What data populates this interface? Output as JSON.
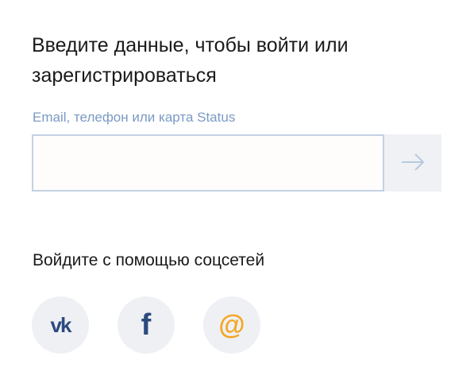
{
  "login": {
    "title": "Введите данные, чтобы войти или зарегистрироваться",
    "field_label": "Email, телефон или карта Status",
    "input_value": "",
    "input_placeholder": "",
    "submit_icon": "arrow-right-icon"
  },
  "social": {
    "title": "Войдите с помощью соцсетей",
    "buttons": [
      {
        "name": "vk",
        "icon": "vk-icon",
        "glyph": "vk"
      },
      {
        "name": "facebook",
        "icon": "facebook-icon",
        "glyph": "f"
      },
      {
        "name": "mail",
        "icon": "at-icon",
        "glyph": "@"
      }
    ]
  },
  "colors": {
    "label": "#7a9ac4",
    "input_border": "#c3d1e4",
    "button_bg": "#eff1f5",
    "arrow": "#b9c9e0",
    "social_icon": "#2c4a7e",
    "mail_accent": "#f5a623"
  }
}
